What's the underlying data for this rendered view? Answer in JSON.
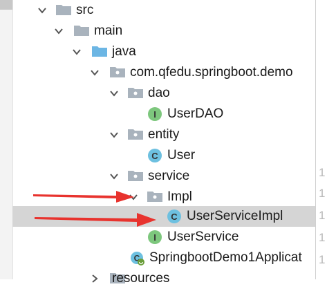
{
  "tree": {
    "src": "src",
    "main": "main",
    "java": "java",
    "package": "com.qfedu.springboot.demo",
    "dao": "dao",
    "userdao": "UserDAO",
    "entity": "entity",
    "user": "User",
    "service": "service",
    "impl": "Impl",
    "userserviceimpl": "UserServiceImpl",
    "userservice": "UserService",
    "app": "SpringbootDemo1Applicat",
    "resources": "resources"
  },
  "icons": {
    "class_badge": "C",
    "interface_badge": "I"
  },
  "gutter": {
    "digits": [
      "1",
      "1",
      "1",
      "1",
      "1"
    ]
  },
  "colors": {
    "selection": "#d5d5d5",
    "folder": "#a9b3bd",
    "source_folder": "#6cb6e4",
    "class_badge": "#6dc0e0",
    "interface_badge": "#7dc77d",
    "annotation_arrow": "#e8332e"
  }
}
